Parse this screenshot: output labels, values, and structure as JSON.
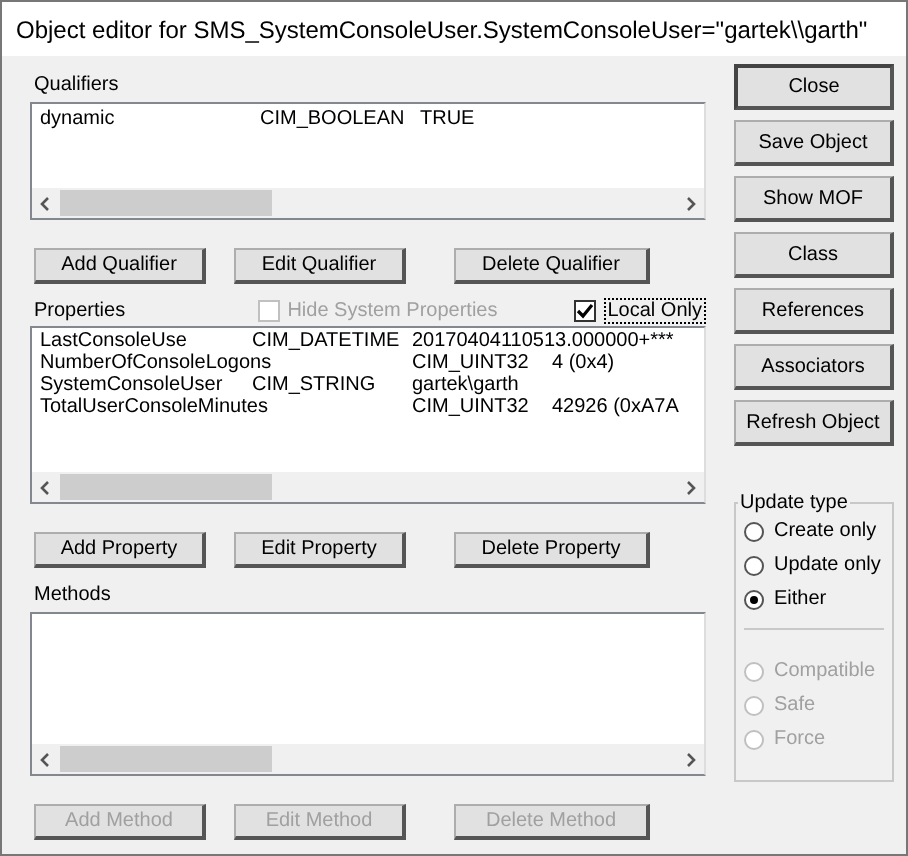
{
  "window": {
    "title": "Object editor for SMS_SystemConsoleUser.SystemConsoleUser=\"gartek\\\\garth\""
  },
  "qualifiers": {
    "label": "Qualifiers",
    "rows": [
      {
        "name": "dynamic",
        "type": "CIM_BOOLEAN",
        "value": "TRUE"
      }
    ],
    "buttons": [
      {
        "label": "Add Qualifier",
        "disabled": false
      },
      {
        "label": "Edit Qualifier",
        "disabled": false
      },
      {
        "label": "Delete Qualifier",
        "disabled": false
      }
    ]
  },
  "properties": {
    "label": "Properties",
    "hide_system": {
      "label": "Hide System Properties",
      "checked": false,
      "disabled": true
    },
    "local_only": {
      "label": "Local Only",
      "checked": true,
      "disabled": false
    },
    "rows": [
      {
        "kind": "aligned",
        "name": "LastConsoleUse",
        "type": "CIM_DATETIME",
        "value": "20170404110513.000000+***"
      },
      {
        "kind": "shifted",
        "name": "NumberOfConsoleLogons",
        "type": "CIM_UINT32",
        "value": "4 (0x4)"
      },
      {
        "kind": "aligned",
        "name": "SystemConsoleUser",
        "type": "CIM_STRING",
        "value": "gartek\\garth"
      },
      {
        "kind": "shifted",
        "name": "TotalUserConsoleMinutes",
        "type": "CIM_UINT32",
        "value": "42926 (0xA7A"
      }
    ],
    "buttons": [
      {
        "label": "Add Property",
        "disabled": false
      },
      {
        "label": "Edit Property",
        "disabled": false
      },
      {
        "label": "Delete Property",
        "disabled": false
      }
    ]
  },
  "methods": {
    "label": "Methods",
    "buttons": [
      {
        "label": "Add Method",
        "disabled": true
      },
      {
        "label": "Edit Method",
        "disabled": true
      },
      {
        "label": "Delete Method",
        "disabled": true
      }
    ]
  },
  "side_buttons": [
    {
      "label": "Close",
      "default": true
    },
    {
      "label": "Save Object",
      "default": false
    },
    {
      "label": "Show MOF",
      "default": false
    },
    {
      "label": "Class",
      "default": false
    },
    {
      "label": "References",
      "default": false
    },
    {
      "label": "Associators",
      "default": false
    },
    {
      "label": "Refresh Object",
      "default": false
    }
  ],
  "update_type": {
    "label": "Update type",
    "options": [
      {
        "label": "Create only",
        "selected": false,
        "disabled": false
      },
      {
        "label": "Update only",
        "selected": false,
        "disabled": false
      },
      {
        "label": "Either",
        "selected": true,
        "disabled": false
      }
    ],
    "modes": [
      {
        "label": "Compatible",
        "selected": false,
        "disabled": true
      },
      {
        "label": "Safe",
        "selected": false,
        "disabled": true
      },
      {
        "label": "Force",
        "selected": false,
        "disabled": true
      }
    ]
  }
}
